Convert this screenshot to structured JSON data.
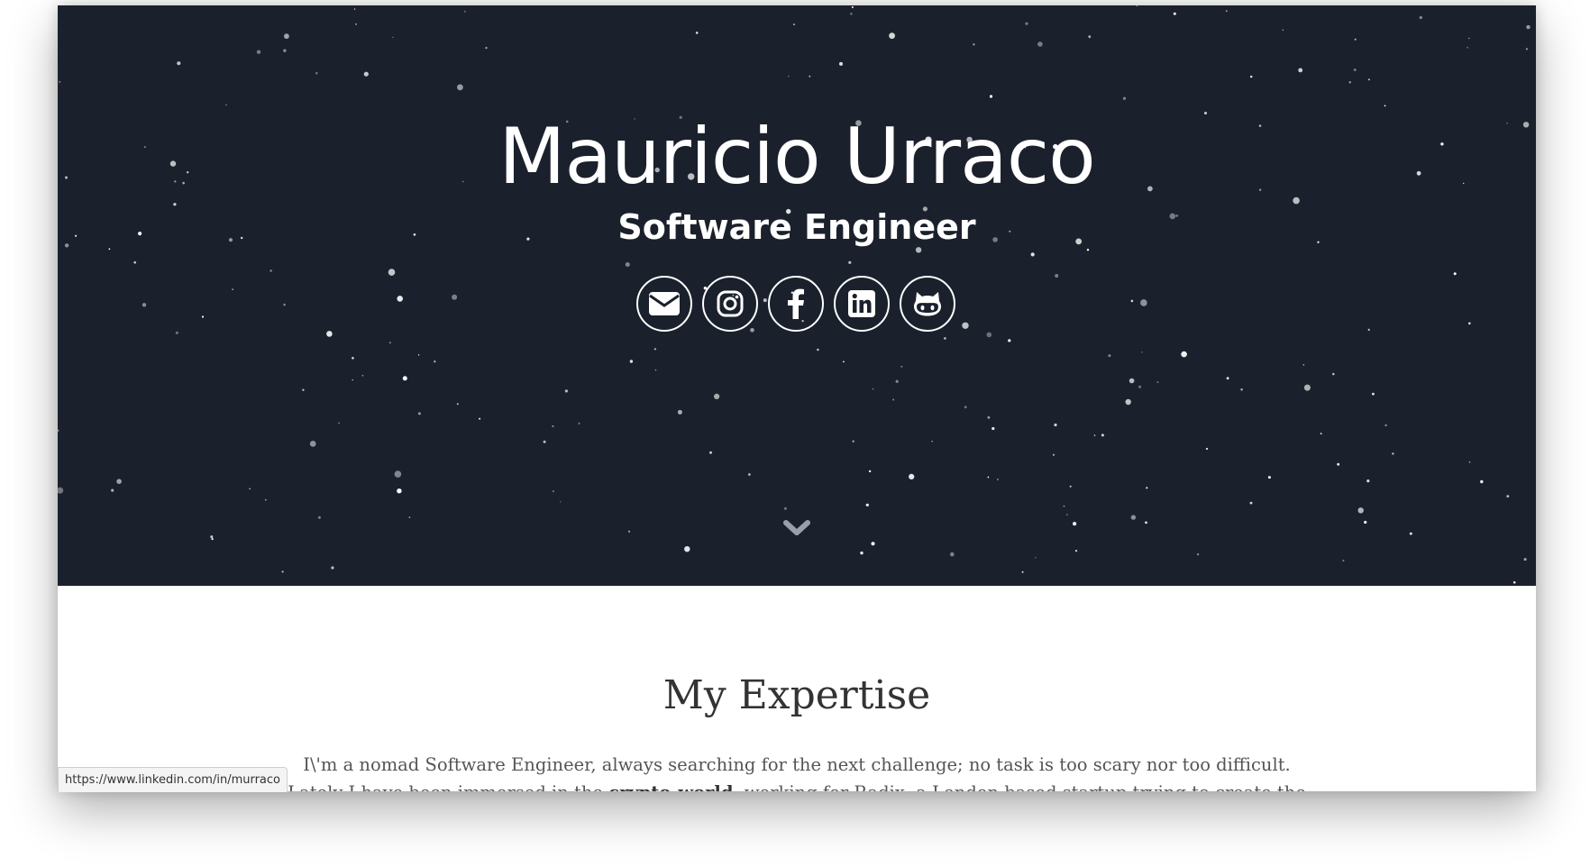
{
  "hero": {
    "name": "Mauricio Urraco",
    "role": "Software Engineer",
    "background_color": "#1b212c",
    "social_links": [
      {
        "icon": "envelope-icon",
        "label": "email"
      },
      {
        "icon": "instagram-icon",
        "label": "instagram"
      },
      {
        "icon": "facebook-icon",
        "label": "facebook"
      },
      {
        "icon": "linkedin-icon",
        "label": "linkedin"
      },
      {
        "icon": "github-icon",
        "label": "github"
      }
    ],
    "scroll_icon": "chevron-down-icon"
  },
  "expertise": {
    "title": "My Expertise",
    "line1": "I\\'m a nomad Software Engineer, always searching for the next challenge; no task is too scary nor too difficult.",
    "line2_before": "Lately I have been immersed in the ",
    "line2_bold": "crypto-world",
    "line2_after": ", working for Radix, a London based startup trying to create the"
  },
  "status_bar": {
    "url": "https://www.linkedin.com/in/murraco"
  }
}
